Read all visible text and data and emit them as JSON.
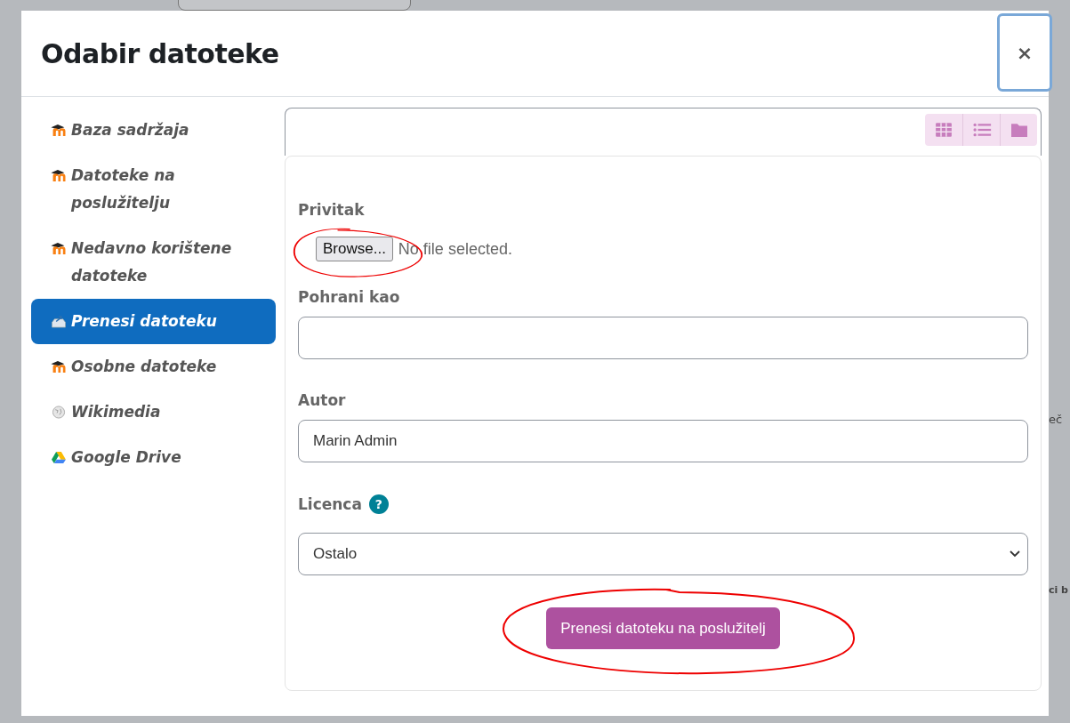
{
  "dialog": {
    "title": "Odabir datoteke",
    "close_label": "×"
  },
  "sidebar": {
    "items": [
      {
        "label": "Baza sadržaja",
        "kind": "moodle",
        "selected": false
      },
      {
        "label": "Datoteke na poslužitelju",
        "kind": "moodle",
        "selected": false
      },
      {
        "label": "Nedavno korištene datoteke",
        "kind": "moodle",
        "selected": false
      },
      {
        "label": "Prenesi datoteku",
        "kind": "upload",
        "selected": true
      },
      {
        "label": "Osobne datoteke",
        "kind": "moodle",
        "selected": false
      },
      {
        "label": "Wikimedia",
        "kind": "wiki",
        "selected": false
      },
      {
        "label": "Google Drive",
        "kind": "drive",
        "selected": false
      }
    ]
  },
  "view_buttons": [
    {
      "kind": "grid"
    },
    {
      "kind": "list"
    },
    {
      "kind": "folder"
    }
  ],
  "form": {
    "attachment": {
      "label": "Privitak",
      "button": "Browse...",
      "status": "No file selected.",
      "circled": true
    },
    "save_as": {
      "label": "Pohrani kao"
    },
    "author": {
      "label": "Autor",
      "value": "Marin Admin"
    },
    "license": {
      "label": "Licenca",
      "help": "?",
      "value": "Ostalo"
    },
    "submit": {
      "label": "Prenesi datoteku na poslužitelj",
      "circled": true
    }
  },
  "background_texts": [
    {
      "text": "eč",
      "bold": false
    },
    {
      "text": "ci b",
      "bold": true
    }
  ]
}
